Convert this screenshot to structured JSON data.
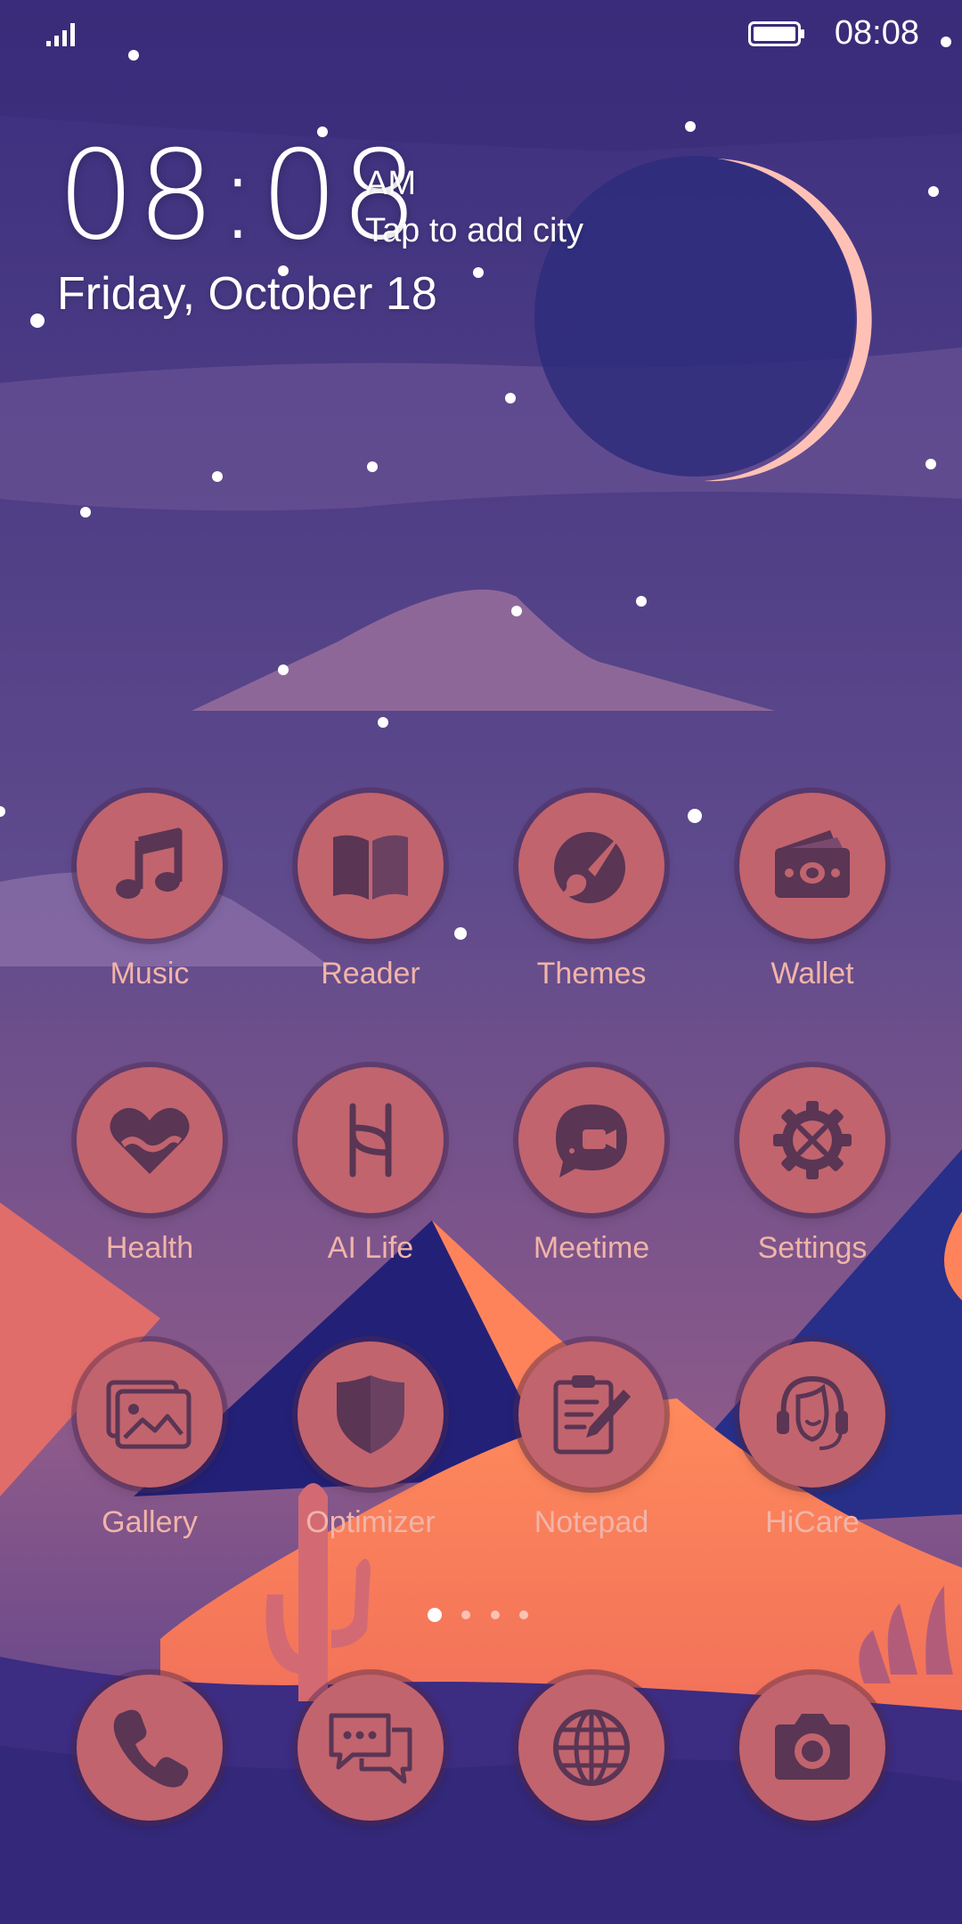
{
  "status_bar": {
    "time": "08:08",
    "signal_icon": "signal-bars-icon",
    "battery_icon": "battery-icon"
  },
  "clock": {
    "time": "08:08",
    "ampm": "AM",
    "city_prompt": "Tap to add city",
    "date": "Friday, October 18"
  },
  "apps": [
    {
      "label": "Music",
      "icon": "music-note-icon"
    },
    {
      "label": "Reader",
      "icon": "book-icon"
    },
    {
      "label": "Themes",
      "icon": "paintbrush-icon"
    },
    {
      "label": "Wallet",
      "icon": "wallet-icon"
    },
    {
      "label": "Health",
      "icon": "heart-icon"
    },
    {
      "label": "AI Life",
      "icon": "ai-life-icon"
    },
    {
      "label": "Meetime",
      "icon": "video-chat-icon"
    },
    {
      "label": "Settings",
      "icon": "gear-icon"
    },
    {
      "label": "Gallery",
      "icon": "gallery-icon"
    },
    {
      "label": "Optimizer",
      "icon": "shield-icon"
    },
    {
      "label": "Notepad",
      "icon": "notepad-icon"
    },
    {
      "label": "HiCare",
      "icon": "headset-icon"
    }
  ],
  "dock": [
    {
      "icon": "phone-icon"
    },
    {
      "icon": "messages-icon"
    },
    {
      "icon": "browser-globe-icon"
    },
    {
      "icon": "camera-icon"
    }
  ],
  "pager": {
    "pages": 4,
    "current": 1
  },
  "colors": {
    "icon_bg": "#c1646e",
    "icon_glyph": "#5a3554",
    "label": "#f1b4a9",
    "sky_top": "#3b2e7e",
    "sand": "#ff7a55"
  }
}
